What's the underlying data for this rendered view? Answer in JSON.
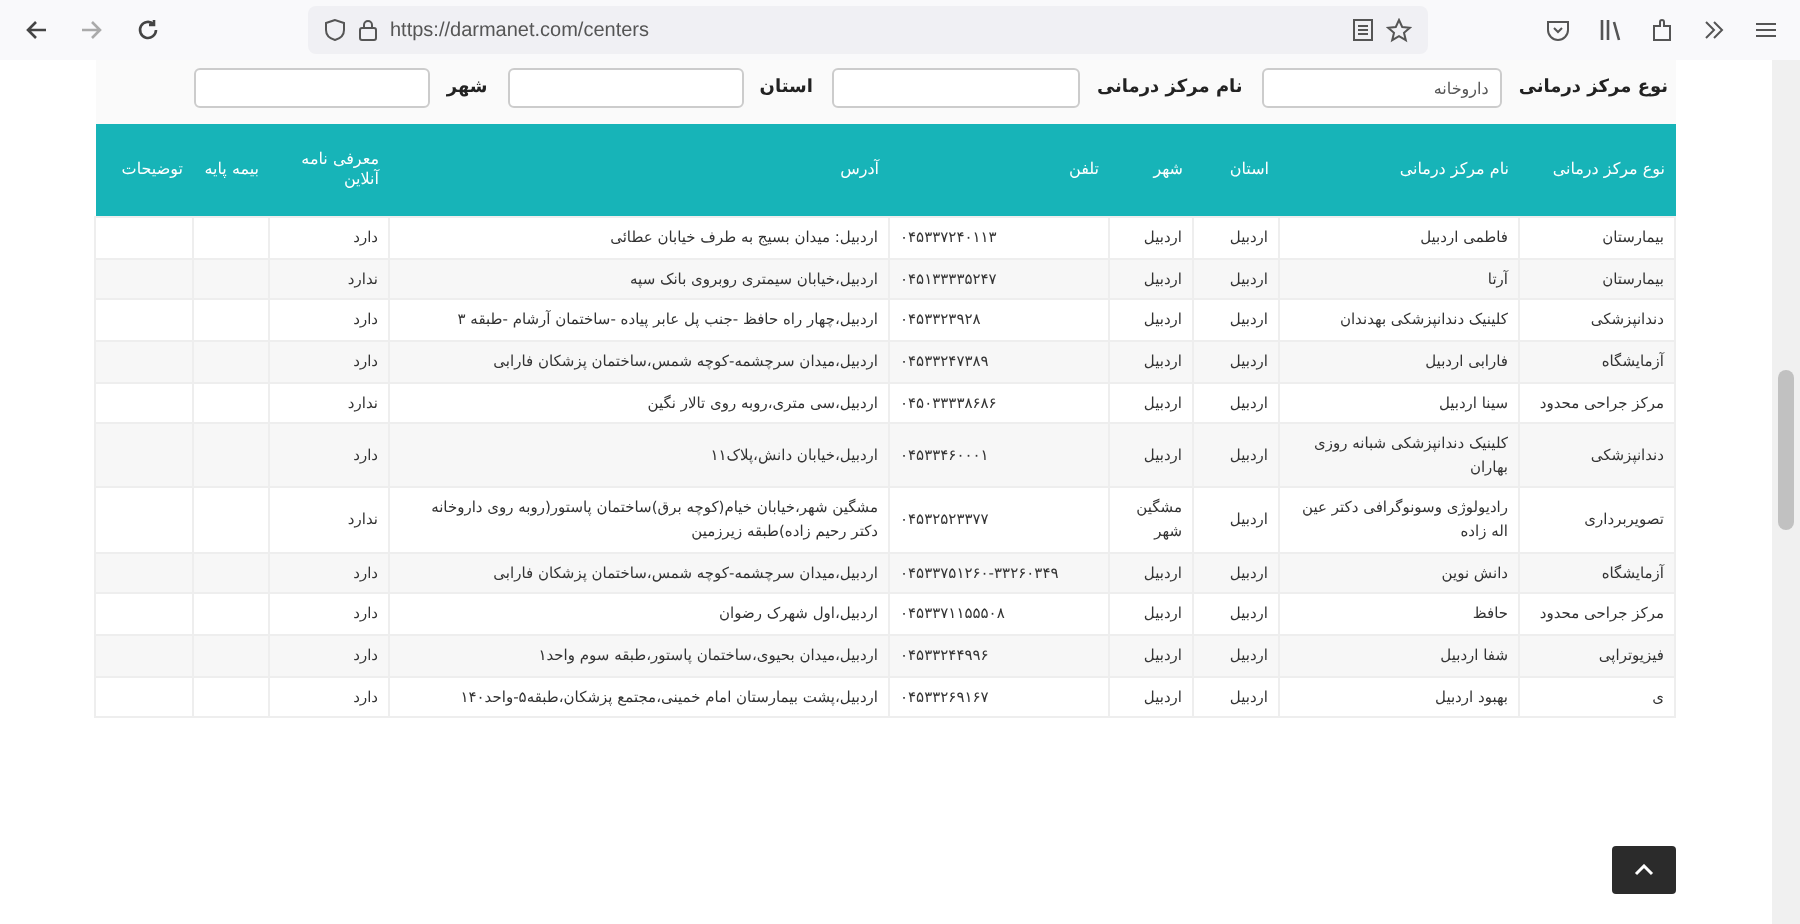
{
  "browser": {
    "url": "https://darmanet.com/centers"
  },
  "filters": [
    {
      "label": "نوع مرکز درمانی",
      "value": "داروخانه"
    },
    {
      "label": "نام مرکز درمانی"
    },
    {
      "label": "استان"
    },
    {
      "label": "شهر"
    }
  ],
  "table": {
    "columns": [
      "نوع مرکز درمانی",
      "نام مرکز درمانی",
      "استان",
      "شهر",
      "تلفن",
      "آدرس",
      "معرفی نامه آنلاین",
      "بیمه پایه",
      "توضیحات"
    ],
    "rows": [
      {
        "type": "بیمارستان",
        "name": "فاطمی اردبیل",
        "province": "اردبیل",
        "city": "اردبیل",
        "phone": "۰۴۵۳۳۷۲۴۰۱۱۳",
        "address": "اردبیل: میدان بسیج به طرف خیابان عطائی",
        "online": "دارد"
      },
      {
        "type": "بیمارستان",
        "name": "آرتا",
        "province": "اردبیل",
        "city": "اردبیل",
        "phone": "۰۴۵۱۳۳۳۳۵۲۴۷",
        "address": "اردبیل،خیابان سیمتری روبروی بانک سپه",
        "online": "ندارد"
      },
      {
        "type": "دندانپزشکی",
        "name": "کلینیک دندانپزشکی بهدندان",
        "province": "اردبیل",
        "city": "اردبیل",
        "phone": "۰۴۵۳۳۲۳۹۲۸",
        "address": "اردبیل،چهار راه حافظ -جنب پل عابر پیاده -ساختمان آرشام -طبقه ۳",
        "online": "دارد"
      },
      {
        "type": "آزمایشگاه",
        "name": "فارابی اردبیل",
        "province": "اردبیل",
        "city": "اردبیل",
        "phone": "۰۴۵۳۳۲۴۷۳۸۹",
        "address": "اردبیل،میدان سرچشمه-کوچه شمس،ساختمان پزشکان فارابی",
        "online": "دارد"
      },
      {
        "type": "مرکز جراحی محدود",
        "name": "سینا اردبیل",
        "province": "اردبیل",
        "city": "اردبیل",
        "phone": "۰۴۵۰۳۳۳۳۸۶۸۶",
        "address": "اردبیل،سی متری،روبه روی تالار نگین",
        "online": "ندارد"
      },
      {
        "type": "دندانپزشکی",
        "name": "کلینیک دندانپزشکی شبانه روزی بهاران",
        "province": "اردبیل",
        "city": "اردبیل",
        "phone": "۰۴۵۳۳۴۶۰۰۰۱",
        "address": "اردبیل،خیابان دانش،پلاک۱۱",
        "online": "دارد"
      },
      {
        "type": "تصویربرداری",
        "name": "رادیولوژی وسونوگرافی دکتر عین اله زاده",
        "province": "اردبیل",
        "city": "مشگین شهر",
        "phone": "۰۴۵۳۲۵۲۳۳۷۷",
        "address": "مشگین شهر،خیابان خیام(کوچه برق)ساختمان پاستور(روبه روی داروخانه دکتر رحیم زاده)طبقه زیرزمین",
        "online": "ندارد"
      },
      {
        "type": "آزمایشگاه",
        "name": "دانش نوین",
        "province": "اردبیل",
        "city": "اردبیل",
        "phone": "۰۴۵۳۳۷۵۱۲۶۰-۳۳۲۶۰۳۴۹",
        "address": "اردبیل،میدان سرچشمه-کوچه شمس،ساختمان پزشکان فارابی",
        "online": "دارد"
      },
      {
        "type": "مرکز جراحی محدود",
        "name": "حافظ",
        "province": "اردبیل",
        "city": "اردبیل",
        "phone": "۰۴۵۳۳۷۱۱۵۵۵۰۸",
        "address": "اردبیل،اول شهرک رضوان",
        "online": "دارد"
      },
      {
        "type": "فیزیوتراپی",
        "name": "شفا اردبیل",
        "province": "اردبیل",
        "city": "اردبیل",
        "phone": "۰۴۵۳۳۲۴۴۹۹۶",
        "address": "اردبیل،میدان بحیوی،ساختمان پاستور،طبقه سوم واحد۱",
        "online": "دارد"
      },
      {
        "type": "ی",
        "name": "بهبود اردبیل",
        "province": "اردبیل",
        "city": "اردبیل",
        "phone": "۰۴۵۳۳۲۶۹۱۶۷",
        "address": "اردبیل،پشت بیمارستان امام خمینی،مجتمع پزشکان،طبقه۵-واحد۱۴۰",
        "online": "دارد"
      }
    ]
  }
}
